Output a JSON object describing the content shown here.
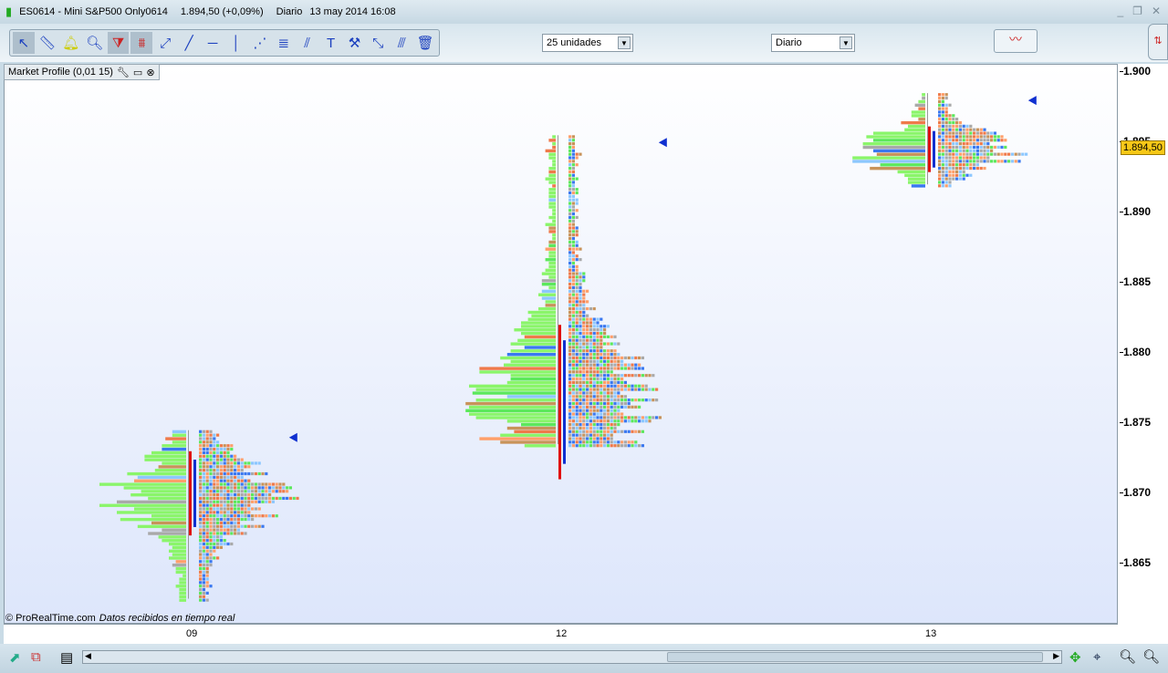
{
  "window": {
    "instrument": "ES0614 - Mini S&P500 Only0614",
    "price": "1.894,50 (+0,09%)",
    "period": "Diario",
    "datetime": "13 may 2014 16:08"
  },
  "toolbar": {
    "tools": [
      "pointer-icon",
      "ruler-icon",
      "alarm-bell-icon",
      "zoom-icon",
      "triangle-pattern-icon",
      "channel-icon",
      "segment-icon",
      "line-icon",
      "horizontal-line-icon",
      "vertical-line-icon",
      "fibonacci-fan-icon",
      "fibonacci-retracement-icon",
      "trend-channel-icon",
      "text-icon",
      "tools-icon",
      "scale-icon",
      "parallel-icon",
      "trash-icon"
    ],
    "units_select": "25 unidades",
    "period_select": "Diario"
  },
  "indicator": {
    "label": "Market Profile (0,01 15)"
  },
  "credit": {
    "brand": "© ProRealTime.com",
    "status": "Datos recibidos en tiempo real"
  },
  "y_axis": {
    "ticks": [
      "1.900",
      "1.895",
      "1.890",
      "1.885",
      "1.880",
      "1.875",
      "1.870",
      "1.865"
    ],
    "current_price": "1.894,50"
  },
  "x_axis": {
    "ticks": [
      "09",
      "12",
      "13"
    ]
  },
  "profiles": [
    {
      "day": "09",
      "low": 1.8625,
      "high": 1.8745,
      "poc": 1.87
    },
    {
      "day": "12",
      "low": 1.8735,
      "high": 1.8955,
      "poc": 1.8765
    },
    {
      "day": "13",
      "low": 1.892,
      "high": 1.8985,
      "poc": 1.8945
    }
  ],
  "colors": {
    "tpo": [
      "#5ce85c",
      "#3a78f0",
      "#ef7a4a",
      "#a9a9a9",
      "#c8935a",
      "#8cc7ff",
      "#ff9f6a"
    ],
    "volume": "#8af56a",
    "poc_line": "#e01010",
    "value_area": "#1030d0",
    "price_tag": "#f7c817"
  }
}
